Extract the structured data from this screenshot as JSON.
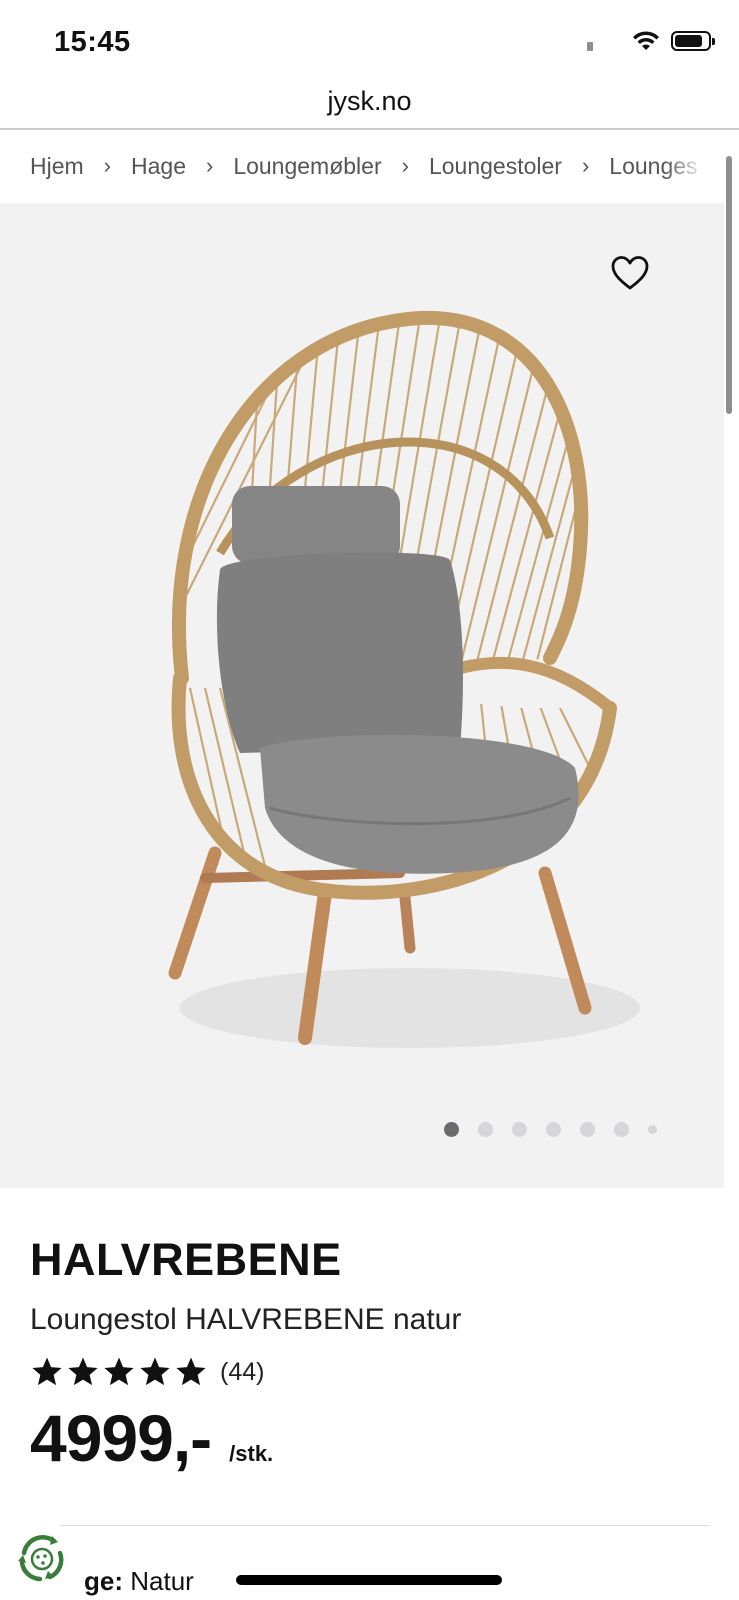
{
  "status_bar": {
    "time": "15:45",
    "icons": [
      "signal-icon",
      "wifi-icon",
      "battery-icon"
    ]
  },
  "browser": {
    "url": "jysk.no"
  },
  "breadcrumb": [
    "Hjem",
    "Hage",
    "Loungemøbler",
    "Loungestoler",
    "Lounges"
  ],
  "gallery": {
    "image_count": 7,
    "active_index": 0,
    "background": "#f3f2f3"
  },
  "product": {
    "brand": "HALVREBENE",
    "name": "Loungestol HALVREBENE natur",
    "rating_stars": 5,
    "rating_count": "(44)",
    "price": "4999,-",
    "unit": "/stk.",
    "color_label": "ge:",
    "color_value": "Natur"
  }
}
